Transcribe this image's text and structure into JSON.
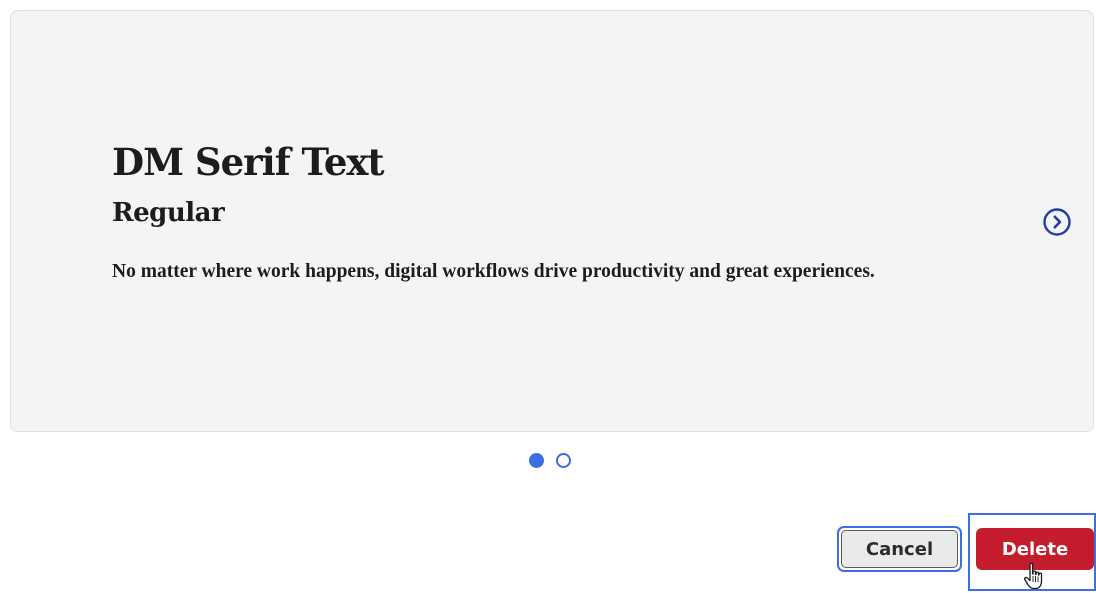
{
  "font_preview": {
    "font_name": "DM Serif Text",
    "weight_label": "Regular",
    "sample_text": "No matter where work happens, digital workflows drive productivity and great experiences."
  },
  "carousel": {
    "next_icon": "chevron-right-circle-icon",
    "slide_count": 2,
    "active_index": 0,
    "accent_color": "#3d6ee0"
  },
  "dialog_actions": {
    "cancel_label": "Cancel",
    "delete_label": "Delete",
    "delete_color": "#c41c2c",
    "focus_color": "#3d6ee0"
  },
  "pointer": {
    "icon": "hand-pointer-icon"
  }
}
